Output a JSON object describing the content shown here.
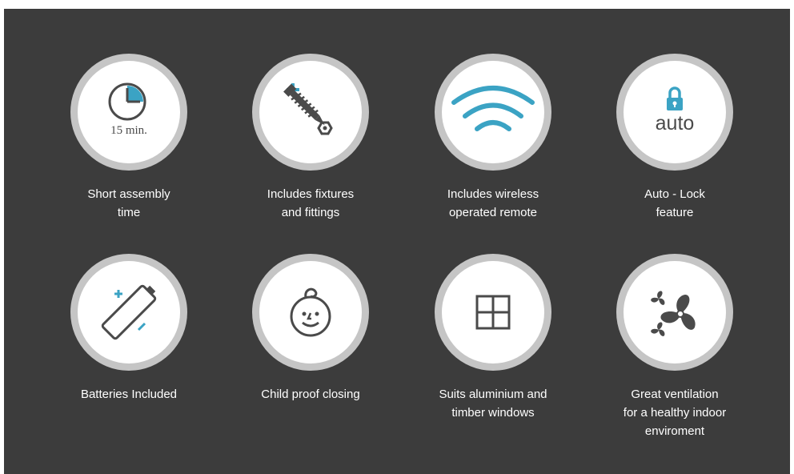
{
  "colors": {
    "panel_background": "#3c3c3c",
    "circle_ring": "#c5c5c5",
    "circle_fill": "#ffffff",
    "icon_dark": "#4a4a4a",
    "icon_accent": "#3ba3c4",
    "caption_text": "#ffffff"
  },
  "features": [
    {
      "icon": "clock-icon",
      "icon_text": "15 min.",
      "lines": [
        "Short assembly",
        "time"
      ]
    },
    {
      "icon": "screw-icon",
      "lines": [
        "Includes fixtures",
        "and fittings"
      ]
    },
    {
      "icon": "wireless-icon",
      "lines": [
        "Includes wireless",
        "operated remote"
      ]
    },
    {
      "icon": "lock-icon",
      "icon_text": "auto",
      "lines": [
        "Auto - Lock",
        "feature"
      ]
    },
    {
      "icon": "battery-icon",
      "lines": [
        "Batteries Included"
      ]
    },
    {
      "icon": "baby-face-icon",
      "lines": [
        "Child proof closing"
      ]
    },
    {
      "icon": "window-icon",
      "lines": [
        "Suits aluminium and",
        "timber windows"
      ]
    },
    {
      "icon": "fan-icon",
      "lines": [
        "Great ventilation",
        "for a healthy indoor",
        "enviroment"
      ]
    }
  ]
}
